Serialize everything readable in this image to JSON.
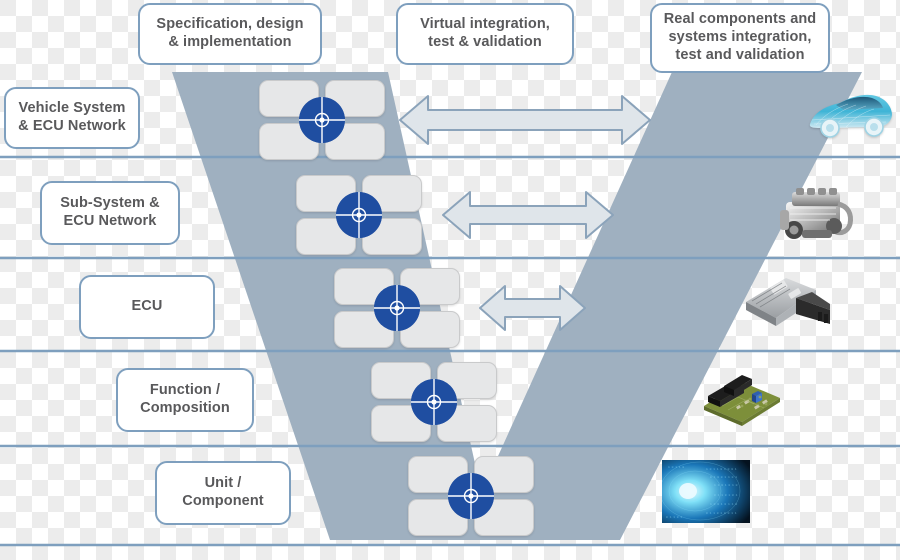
{
  "diagram": {
    "title": "Automotive V-Model development process",
    "headers": [
      {
        "id": "spec",
        "label": "Specification, design\n& implementation"
      },
      {
        "id": "virtual",
        "label": "Virtual integration,\ntest & validation"
      },
      {
        "id": "real",
        "label": "Real components and\nsystems integration,\ntest and validation"
      }
    ],
    "levels": [
      {
        "id": "vehicle-system",
        "label": "Vehicle System\n& ECU Network",
        "image": "car-image",
        "image_alt": "Vehicle wireframe car"
      },
      {
        "id": "sub-system",
        "label": "Sub-System &\nECU Network",
        "image": "engine-image",
        "image_alt": "Engine"
      },
      {
        "id": "ecu",
        "label": "ECU",
        "image": "ecu-image",
        "image_alt": "Electronic control unit"
      },
      {
        "id": "function",
        "label": "Function /\nComposition",
        "image": "pcb-image",
        "image_alt": "Printed circuit board"
      },
      {
        "id": "unit",
        "label": "Unit /\nComponent",
        "image": "binary-image",
        "image_alt": "Binary data tunnel"
      }
    ],
    "arrows": [
      {
        "id": "arrow-vehicle",
        "direction": "bidirectional"
      },
      {
        "id": "arrow-sub-system",
        "direction": "bidirectional"
      },
      {
        "id": "arrow-ecu",
        "direction": "bidirectional"
      }
    ],
    "colors": {
      "v_band": "#9fb0c0",
      "box_border": "#7e9fbe",
      "text": "#59595b",
      "hub_blue": "#1f4ea1",
      "divider": "#7e9fbe",
      "tile": "#e6e7e8",
      "arrow_fill": "#dfe5ea",
      "arrow_border": "#8ba3ba"
    }
  }
}
